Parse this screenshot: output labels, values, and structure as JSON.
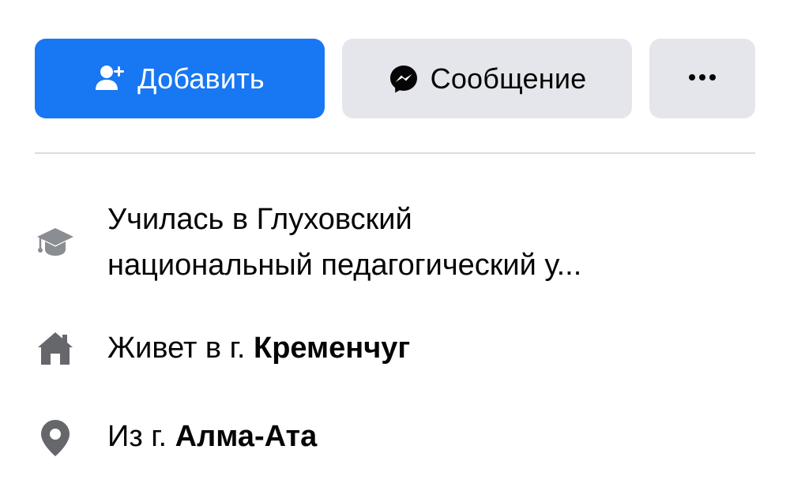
{
  "actions": {
    "add_label": "Добавить",
    "message_label": "Сообщение",
    "more_label": "•••"
  },
  "about": {
    "education": {
      "line1": "Училась в Глуховский",
      "line2": "национальный педагогический у..."
    },
    "lives": {
      "prefix": "Живет в г. ",
      "place": "Кременчуг"
    },
    "from": {
      "prefix": "Из г. ",
      "place": "Алма-Ата"
    }
  },
  "colors": {
    "primary": "#1877f2",
    "secondary_bg": "#e4e6eb",
    "icon_gray": "#65676b",
    "divider": "#dadde1"
  },
  "icons": {
    "add": "add-friend-icon",
    "message": "messenger-icon",
    "more": "more-dots-icon",
    "education": "graduation-cap-icon",
    "home": "home-icon",
    "location": "location-pin-icon"
  }
}
